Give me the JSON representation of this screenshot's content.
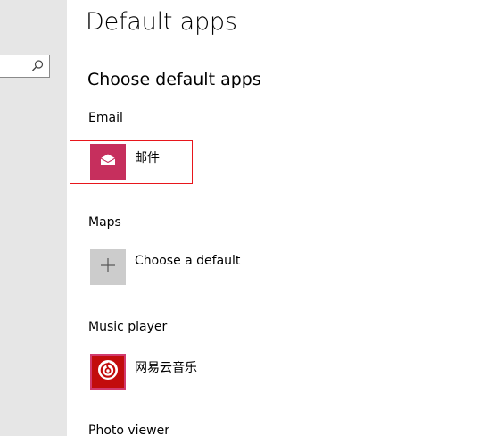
{
  "window": {
    "page_title": "Default apps"
  },
  "search": {
    "icon": "search-icon"
  },
  "main": {
    "section_title": "Choose default apps",
    "categories": [
      {
        "label": "Email",
        "app_name": "邮件",
        "icon": "mail-icon",
        "tile_color": "#c62f5d"
      },
      {
        "label": "Maps",
        "app_name": "Choose a default",
        "icon": "plus-icon",
        "tile_color": "#cccccc"
      },
      {
        "label": "Music player",
        "app_name": "网易云音乐",
        "icon": "netease-music-icon",
        "tile_color": "#c20c0c"
      },
      {
        "label": "Photo viewer"
      }
    ]
  },
  "colors": {
    "highlight": "#e8161c",
    "left_pane": "#e6e6e6"
  }
}
